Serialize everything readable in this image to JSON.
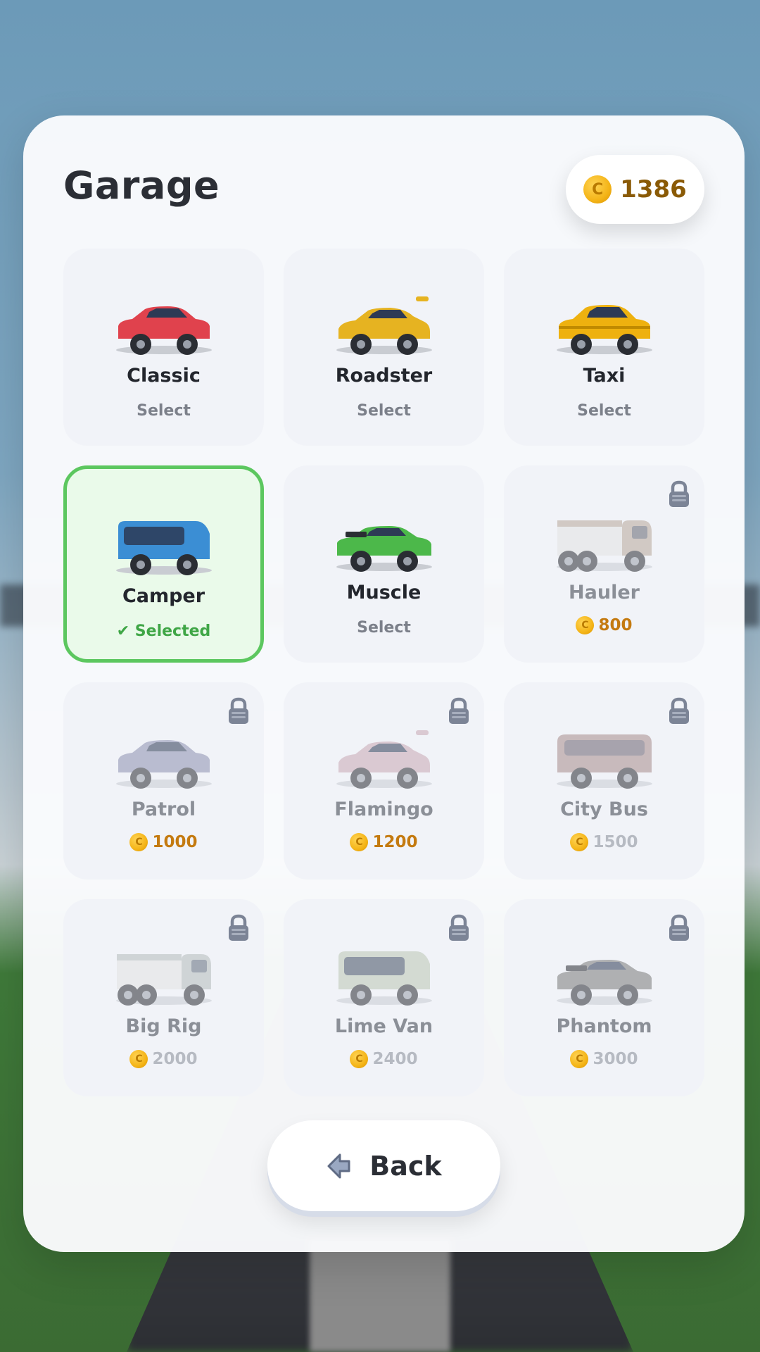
{
  "header": {
    "title": "Garage",
    "coins": "1386",
    "coin_symbol": "C"
  },
  "cars": [
    {
      "name": "Classic",
      "status": "Select",
      "price": null,
      "locked": false,
      "selected": false,
      "body": "#e0424d",
      "shape": "sedan",
      "price_dim": false
    },
    {
      "name": "Roadster",
      "status": "Select",
      "price": null,
      "locked": false,
      "selected": false,
      "body": "#e6b321",
      "shape": "sport",
      "price_dim": false
    },
    {
      "name": "Taxi",
      "status": "Select",
      "price": null,
      "locked": false,
      "selected": false,
      "body": "#eeb10f",
      "shape": "taxi",
      "price_dim": false
    },
    {
      "name": "Camper",
      "status": "✔ Selected",
      "price": null,
      "locked": false,
      "selected": true,
      "body": "#3b8ed4",
      "shape": "van",
      "price_dim": false
    },
    {
      "name": "Muscle",
      "status": "Select",
      "price": null,
      "locked": false,
      "selected": false,
      "body": "#4cb84a",
      "shape": "muscle",
      "price_dim": false
    },
    {
      "name": "Hauler",
      "status": null,
      "price": "800",
      "locked": true,
      "selected": false,
      "body": "#b8a89a",
      "shape": "truck",
      "price_dim": false
    },
    {
      "name": "Patrol",
      "status": null,
      "price": "1000",
      "locked": true,
      "selected": false,
      "body": "#8c90b0",
      "shape": "sedan",
      "price_dim": false
    },
    {
      "name": "Flamingo",
      "status": null,
      "price": "1200",
      "locked": true,
      "selected": false,
      "body": "#c9a7b4",
      "shape": "sport",
      "price_dim": false
    },
    {
      "name": "City Bus",
      "status": null,
      "price": "1500",
      "locked": true,
      "selected": false,
      "body": "#a88c8c",
      "shape": "bus",
      "price_dim": true
    },
    {
      "name": "Big Rig",
      "status": null,
      "price": "2000",
      "locked": true,
      "selected": false,
      "body": "#b5bcbc",
      "shape": "truck",
      "price_dim": true
    },
    {
      "name": "Lime Van",
      "status": null,
      "price": "2400",
      "locked": true,
      "selected": false,
      "body": "#bcc7b4",
      "shape": "van",
      "price_dim": true
    },
    {
      "name": "Phantom",
      "status": null,
      "price": "3000",
      "locked": true,
      "selected": false,
      "body": "#7a7a7a",
      "shape": "muscle",
      "price_dim": true
    }
  ],
  "footer": {
    "back_label": "Back"
  },
  "colors": {
    "accent_selected": "#5cc75f",
    "coin": "#f4b417",
    "price": "#c47a10"
  }
}
